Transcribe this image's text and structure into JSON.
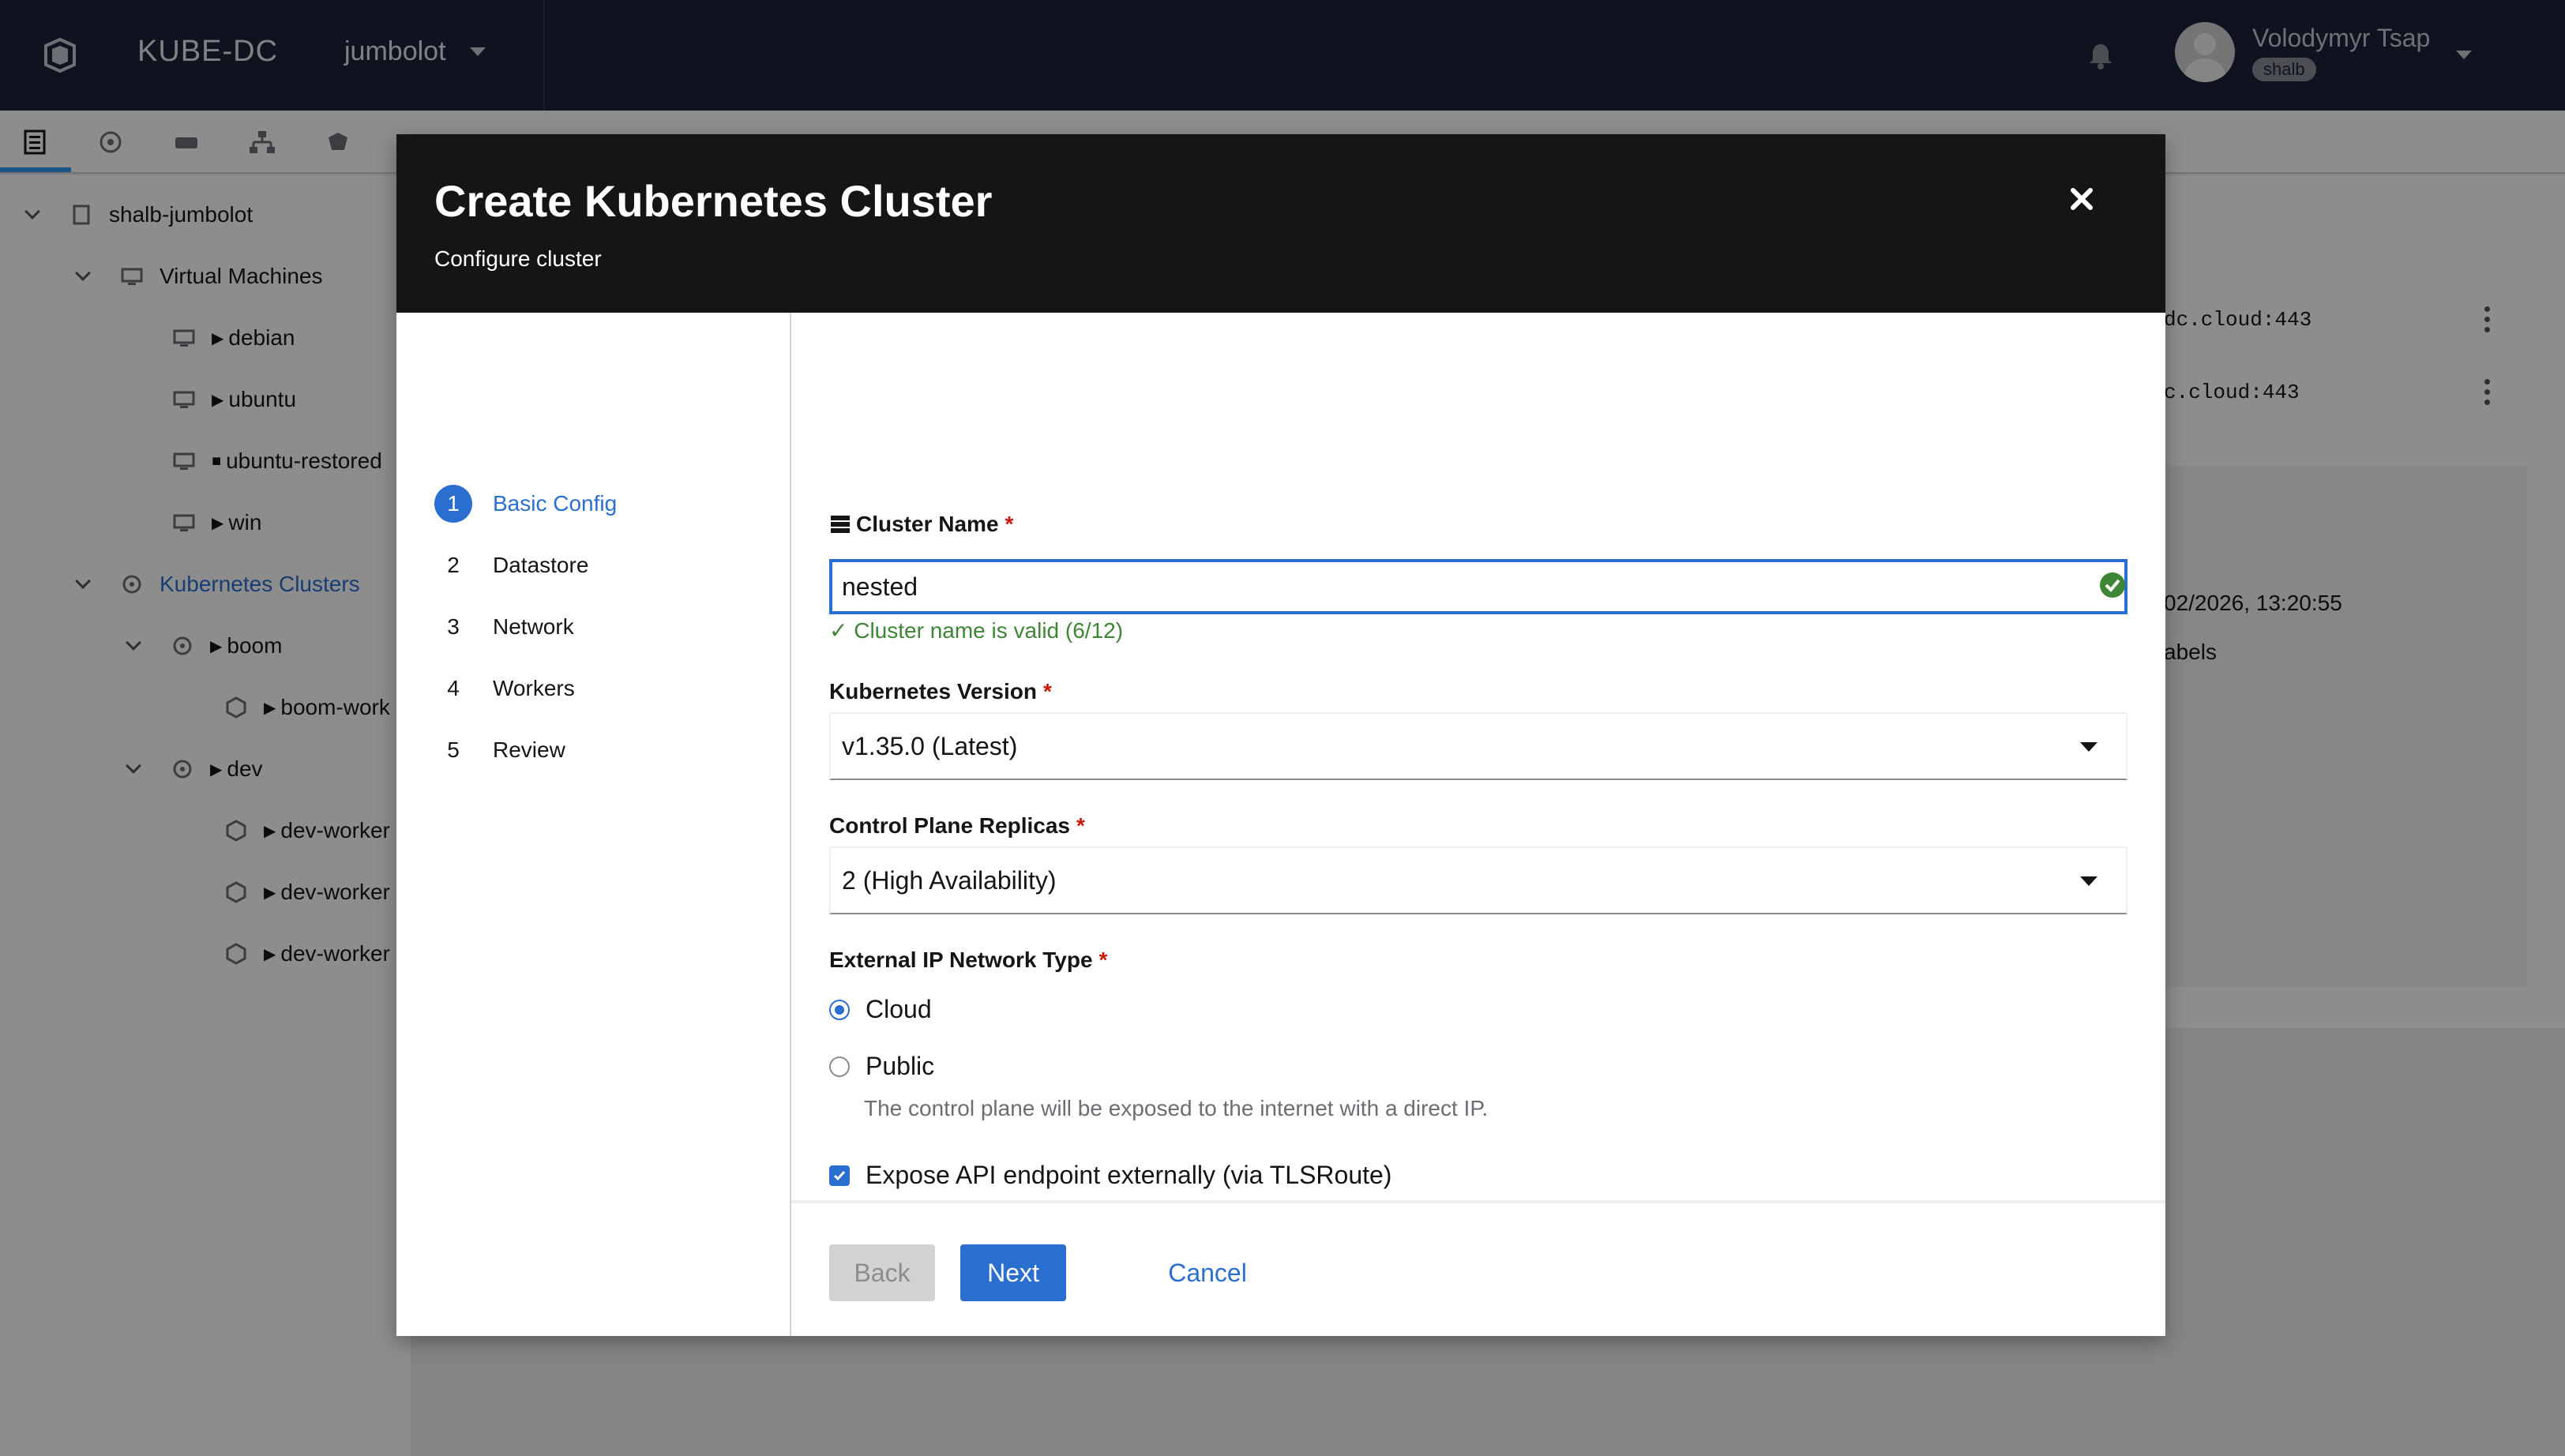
{
  "topbar": {
    "brand": "KUBE-DC",
    "project": "jumbolot",
    "user_name": "Volodymyr Tsap",
    "user_badge": "shalb"
  },
  "tree": {
    "items": [
      {
        "label": "shalb-jumbolot"
      },
      {
        "label": "Virtual Machines"
      },
      {
        "label": "debian"
      },
      {
        "label": "ubuntu"
      },
      {
        "label": "ubuntu-restored"
      },
      {
        "label": "win"
      },
      {
        "label": "Kubernetes Clusters"
      },
      {
        "label": "boom"
      },
      {
        "label": "boom-work"
      },
      {
        "label": "dev"
      },
      {
        "label": "dev-worker"
      },
      {
        "label": "dev-worker"
      },
      {
        "label": "dev-worker"
      }
    ]
  },
  "background": {
    "row1": "dc.cloud:443",
    "row2": "c.cloud:443",
    "timestamp": "02/2026, 13:20:55",
    "labels": "abels"
  },
  "modal": {
    "title": "Create Kubernetes Cluster",
    "subtitle": "Configure cluster",
    "steps": [
      {
        "num": "1",
        "label": "Basic Config"
      },
      {
        "num": "2",
        "label": "Datastore"
      },
      {
        "num": "3",
        "label": "Network"
      },
      {
        "num": "4",
        "label": "Workers"
      },
      {
        "num": "5",
        "label": "Review"
      }
    ],
    "cluster_name_label": "Cluster Name",
    "cluster_name_value": "nested",
    "cluster_name_valid": "✓ Cluster name is valid (6/12)",
    "k8s_version_label": "Kubernetes Version",
    "k8s_version_value": "v1.35.0 (Latest)",
    "replicas_label": "Control Plane Replicas",
    "replicas_value": "2 (High Availability)",
    "network_type_label": "External IP Network Type",
    "network_options": [
      {
        "label": "Cloud",
        "checked": true
      },
      {
        "label": "Public",
        "checked": false
      }
    ],
    "public_desc": "The control plane will be exposed to the internet with a direct IP.",
    "expose_api_label": "Expose API endpoint externally (via TLSRoute)",
    "expose_api_checked": true,
    "buttons": {
      "back": "Back",
      "next": "Next",
      "cancel": "Cancel"
    }
  },
  "colors": {
    "accent": "#2a6ecf",
    "header_bg": "#1b2237",
    "modal_header_bg": "#151515",
    "success": "#3e8635",
    "required": "#c9190b"
  }
}
